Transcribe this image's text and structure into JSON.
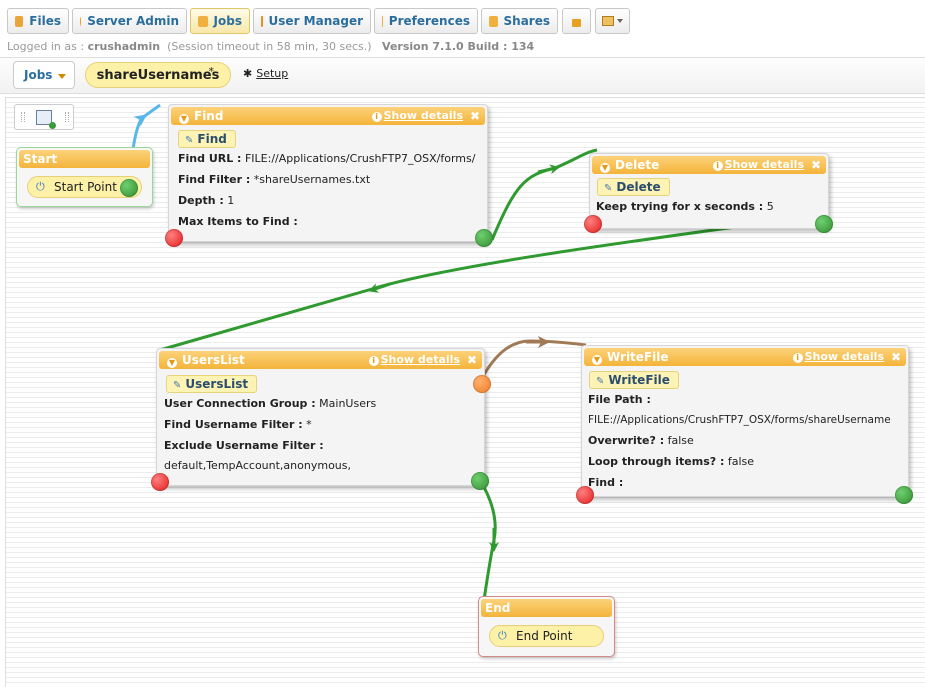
{
  "tabs": [
    {
      "label": "Files"
    },
    {
      "label": "Server Admin"
    },
    {
      "label": "Jobs"
    },
    {
      "label": "User Manager"
    },
    {
      "label": "Preferences"
    },
    {
      "label": "Shares"
    }
  ],
  "status": {
    "logged_in_prefix": "Logged in as :",
    "user": "crushadmin",
    "session": "(Session timeout in 58 min, 30 secs.)",
    "version": "Version 7.1.0 Build : 134"
  },
  "toolbar": {
    "jobs_select": "Jobs",
    "job_name": "shareUsernames",
    "modified_mark": "*",
    "setup_label": "Setup"
  },
  "common": {
    "show_details": "Show details",
    "close": "✖"
  },
  "nodes": {
    "start": {
      "title": "Start",
      "label": "Start Point"
    },
    "find": {
      "title": "Find",
      "chip": "Find",
      "rows": [
        {
          "k": "Find URL :",
          "v": "FILE://Applications/CrushFTP7_OSX/forms/"
        },
        {
          "k": "Find Filter :",
          "v": "*shareUsernames.txt"
        },
        {
          "k": "Depth :",
          "v": "1"
        },
        {
          "k": "Max Items to Find :",
          "v": ""
        }
      ]
    },
    "delete": {
      "title": "Delete",
      "chip": "Delete",
      "rows": [
        {
          "k": "Keep trying for x seconds :",
          "v": "5"
        }
      ]
    },
    "userslist": {
      "title": "UsersList",
      "chip": "UsersList",
      "rows": [
        {
          "k": "User Connection Group :",
          "v": "MainUsers"
        },
        {
          "k": "Find Username Filter :",
          "v": "*"
        },
        {
          "k": "Exclude Username Filter :",
          "v": ""
        },
        {
          "k": "",
          "v": "default,TempAccount,anonymous,"
        }
      ]
    },
    "writefile": {
      "title": "WriteFile",
      "chip": "WriteFile",
      "rows": [
        {
          "k": "File Path :",
          "v": ""
        },
        {
          "k": "",
          "v": "FILE://Applications/CrushFTP7_OSX/forms/shareUsername"
        },
        {
          "k": "Overwrite? :",
          "v": "false"
        },
        {
          "k": "Loop through items? :",
          "v": "false"
        },
        {
          "k": "Find :",
          "v": ""
        }
      ]
    },
    "end": {
      "title": "End",
      "label": "End Point"
    }
  },
  "colors": {
    "success_link": "#2f9a2f",
    "start_link": "#5ab8e8",
    "error_link": "#a07a55",
    "header_orange": "#f4b43a",
    "tab_text": "#2b6e9e"
  }
}
